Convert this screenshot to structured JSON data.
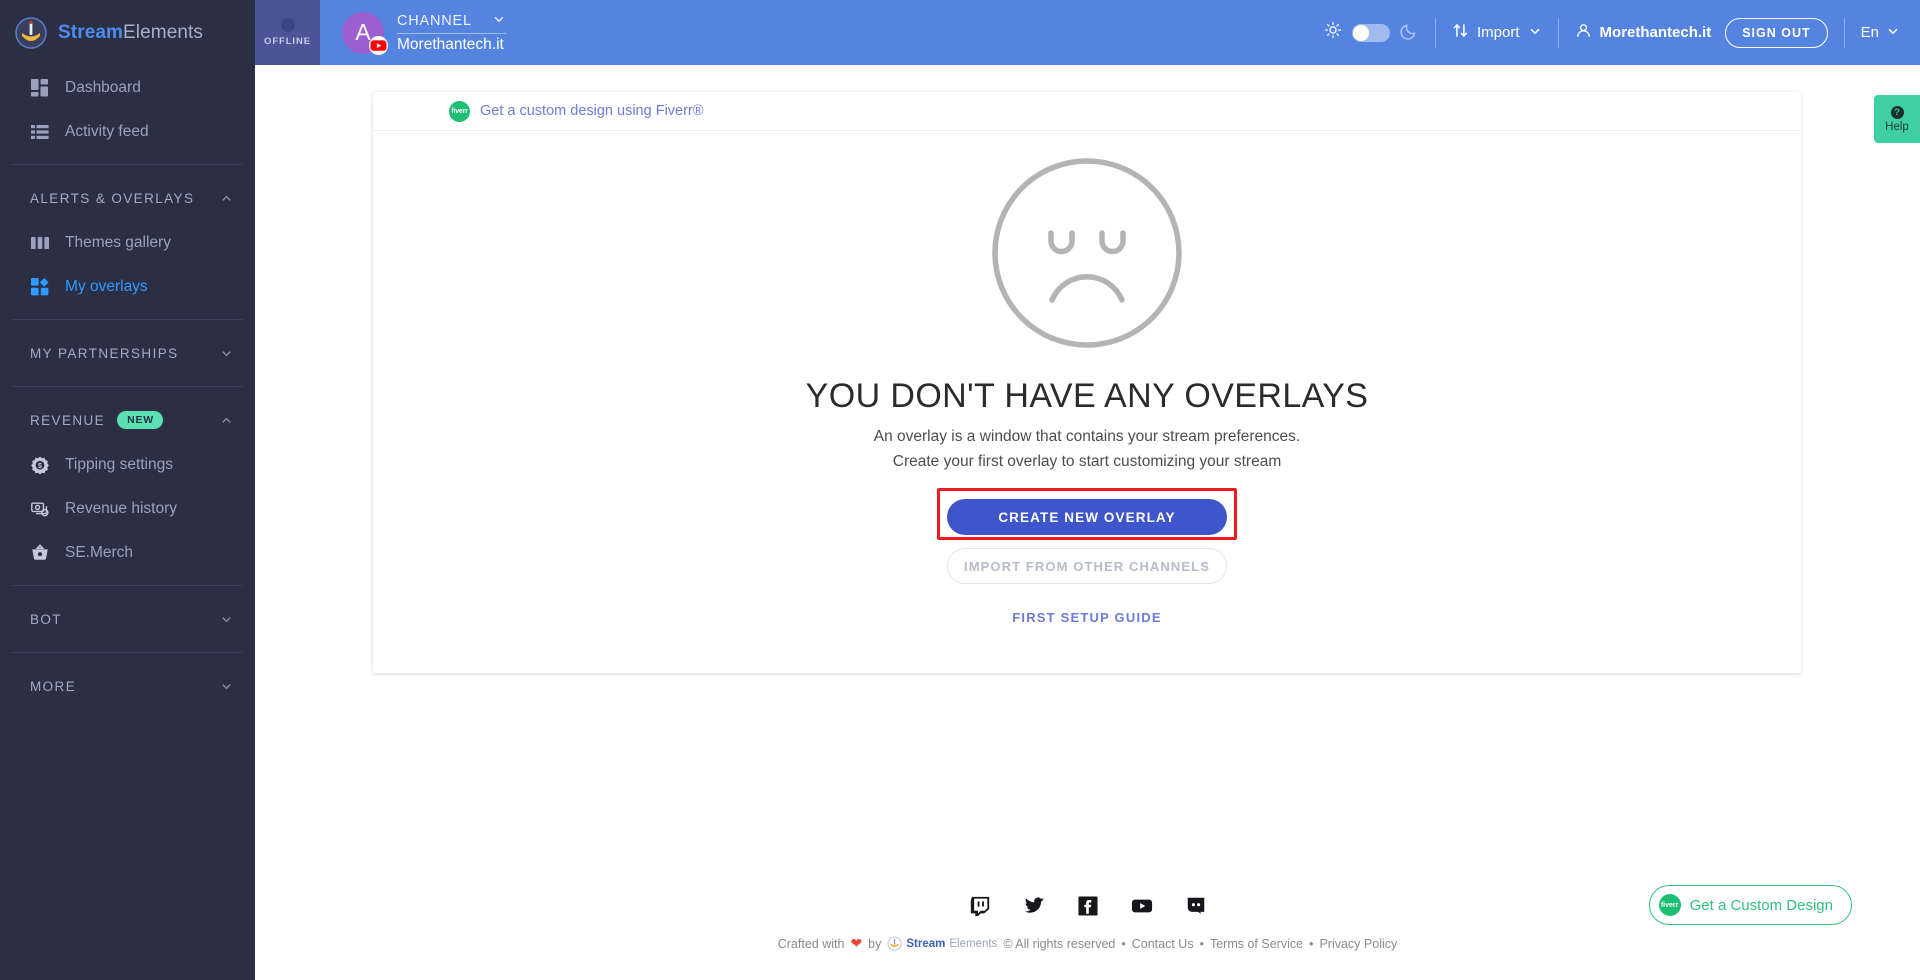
{
  "brand": {
    "name_bold": "Stream",
    "name_light": "Elements",
    "logo_icon": "streamelements-rocket-logo"
  },
  "sidebar": {
    "top_items": [
      {
        "label": "Dashboard",
        "icon": "dashboard-grid-icon",
        "active": false
      },
      {
        "label": "Activity feed",
        "icon": "list-icon",
        "active": false
      }
    ],
    "groups": [
      {
        "title": "ALERTS & OVERLAYS",
        "expanded": true,
        "chevron": "chevron-up-icon",
        "badge": "",
        "items": [
          {
            "label": "Themes gallery",
            "icon": "gallery-columns-icon",
            "active": false
          },
          {
            "label": "My overlays",
            "icon": "overlays-blocks-icon",
            "active": true
          }
        ]
      },
      {
        "title": "MY PARTNERSHIPS",
        "expanded": false,
        "chevron": "chevron-down-icon",
        "badge": "",
        "items": []
      },
      {
        "title": "REVENUE",
        "expanded": true,
        "chevron": "chevron-up-icon",
        "badge": "NEW",
        "items": [
          {
            "label": "Tipping settings",
            "icon": "gear-dollar-icon",
            "active": false
          },
          {
            "label": "Revenue history",
            "icon": "receipt-icon",
            "active": false
          },
          {
            "label": "SE.Merch",
            "icon": "basket-icon",
            "active": false
          }
        ]
      },
      {
        "title": "BOT",
        "expanded": false,
        "chevron": "chevron-down-icon",
        "badge": "",
        "items": []
      },
      {
        "title": "MORE",
        "expanded": false,
        "chevron": "chevron-down-icon",
        "badge": "",
        "items": []
      }
    ]
  },
  "header": {
    "stream_status": "OFFLINE",
    "status_icon": "status-dot-icon",
    "avatar_letter": "A",
    "platform_icon": "youtube-badge-icon",
    "channel_label": "CHANNEL",
    "channel_chevron": "chevron-down-icon",
    "channel_name": "Morethantech.it",
    "theme": {
      "light_icon": "sun-icon",
      "dark_icon": "moon-icon",
      "toggle_state": "light"
    },
    "import": {
      "label": "Import",
      "icon": "import-arrows-icon",
      "chevron": "chevron-down-icon"
    },
    "user": {
      "name": "Morethantech.it",
      "icon": "user-outline-icon"
    },
    "sign_out_label": "SIGN OUT",
    "language": {
      "label": "En",
      "chevron": "chevron-down-icon"
    }
  },
  "main": {
    "fiverr_banner": {
      "label": "Get a custom design using Fiverr®",
      "icon": "fiverr-logo-icon",
      "badge_text": "fiverr"
    },
    "empty_state": {
      "icon": "sad-face-icon",
      "title": "YOU DON'T HAVE ANY OVERLAYS",
      "subtitle_line1": "An overlay is a window that contains your stream preferences.",
      "subtitle_line2": "Create your first overlay to start customizing your stream",
      "primary_button": "CREATE NEW OVERLAY",
      "secondary_button": "IMPORT FROM OTHER CHANNELS",
      "setup_link": "FIRST SETUP GUIDE"
    },
    "highlight_color": "#ee1c22"
  },
  "footer": {
    "socials": [
      {
        "name": "twitch-icon"
      },
      {
        "name": "twitter-icon"
      },
      {
        "name": "facebook-icon"
      },
      {
        "name": "youtube-icon"
      },
      {
        "name": "discord-icon"
      }
    ],
    "crafted_prefix": "Crafted with",
    "heart_icon": "heart-icon",
    "crafted_by": "by",
    "brand_bold": "Stream",
    "brand_light": "Elements",
    "rights": "© All rights reserved",
    "sep": "•",
    "links": [
      "Contact Us",
      "Terms of Service",
      "Privacy Policy"
    ]
  },
  "floating": {
    "help": {
      "label": "Help",
      "icon": "question-mark-icon",
      "color": "#3ed0a3"
    },
    "custom_design": {
      "label": "Get a Custom Design",
      "icon": "fiverr-logo-icon",
      "badge_text": "fiverr",
      "color": "#2fc37f"
    }
  }
}
